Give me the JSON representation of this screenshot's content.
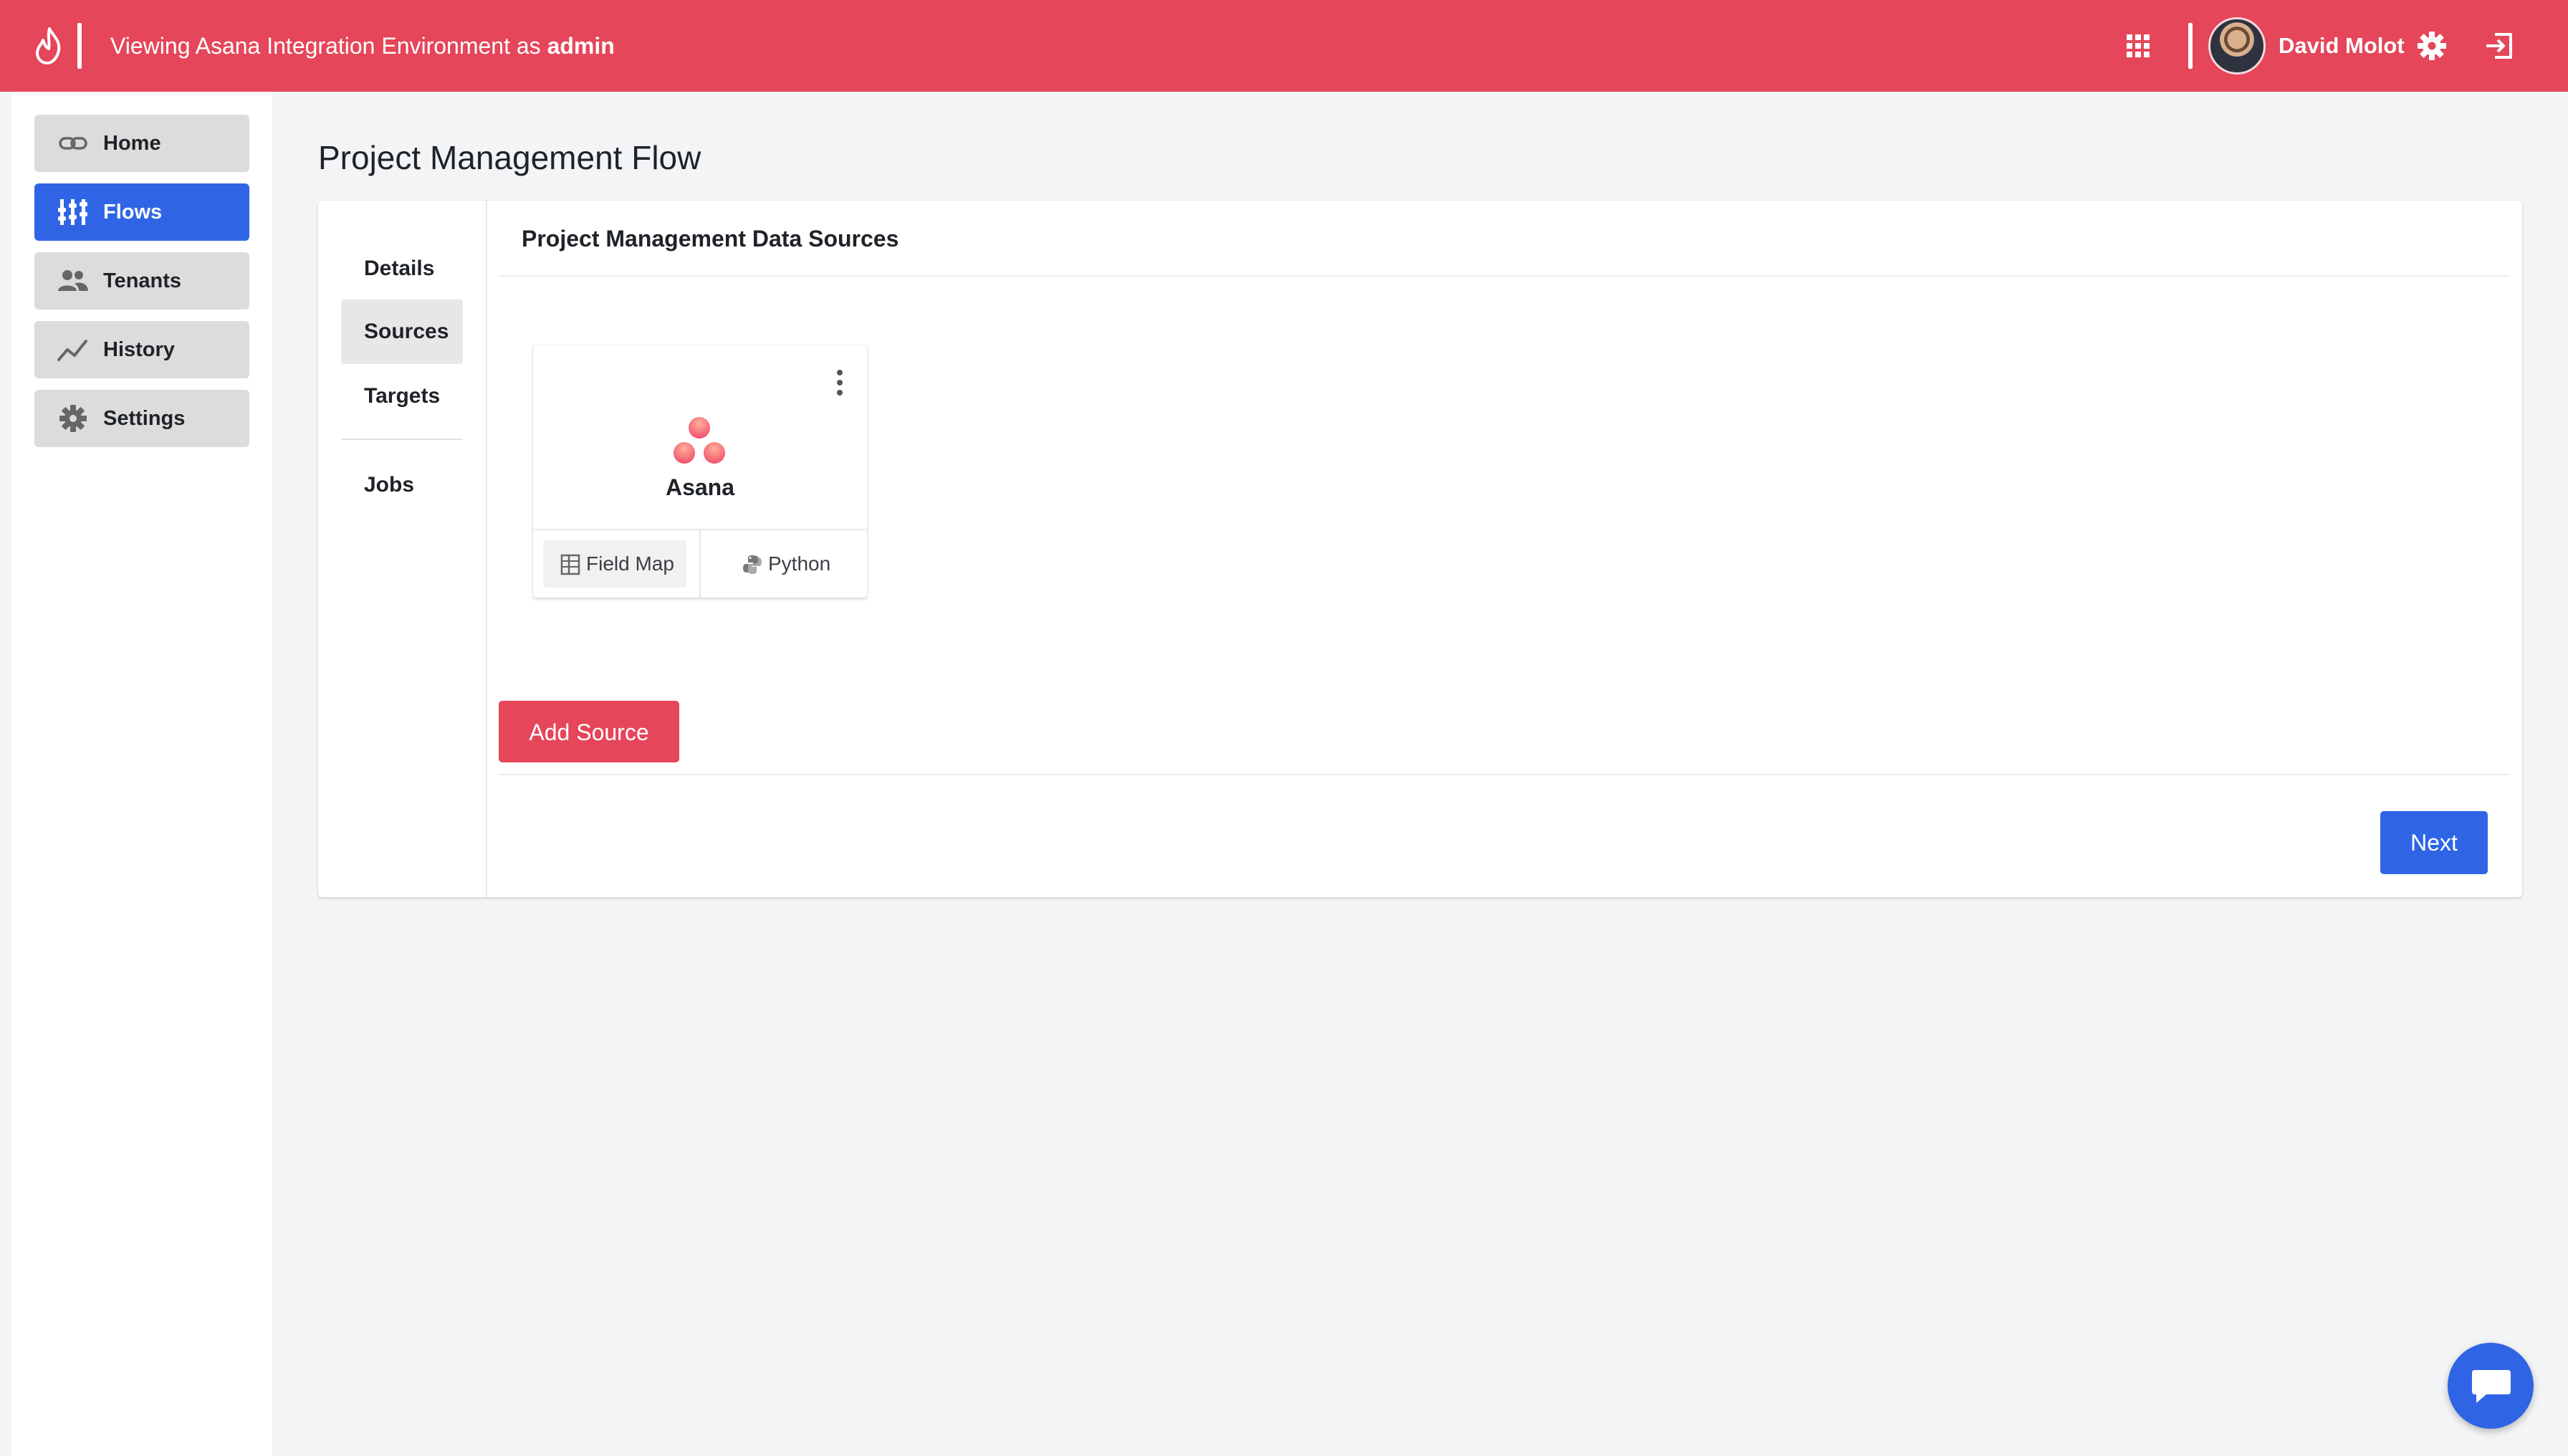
{
  "topbar": {
    "env_prefix": "Viewing Asana Integration Environment as ",
    "env_role": "admin",
    "user_name": "David Molot",
    "icons": [
      "flame-logo-icon",
      "apps-grid-icon",
      "settings-gear-icon",
      "logout-icon"
    ],
    "bg_color": "#e5465a"
  },
  "nav": {
    "items": [
      {
        "label": "Home",
        "icon": "link-icon"
      },
      {
        "label": "Flows",
        "icon": "flows-icon",
        "active": true
      },
      {
        "label": "Tenants",
        "icon": "people-icon"
      },
      {
        "label": "History",
        "icon": "trend-line-icon"
      },
      {
        "label": "Settings",
        "icon": "gear-icon"
      }
    ],
    "active_color": "#2f65e5"
  },
  "page": {
    "title": "Project Management Flow"
  },
  "steps": {
    "items": [
      "Details",
      "Sources",
      "Targets",
      "Jobs"
    ],
    "active": "Sources"
  },
  "content": {
    "heading": "Project Management Data Sources",
    "source_card": {
      "name": "Asana",
      "field_map_label": "Field Map",
      "python_label": "Python"
    },
    "add_source_label": "Add Source",
    "next_label": "Next"
  },
  "colors": {
    "primary_red": "#e5465a",
    "primary_blue": "#2f65e5"
  }
}
